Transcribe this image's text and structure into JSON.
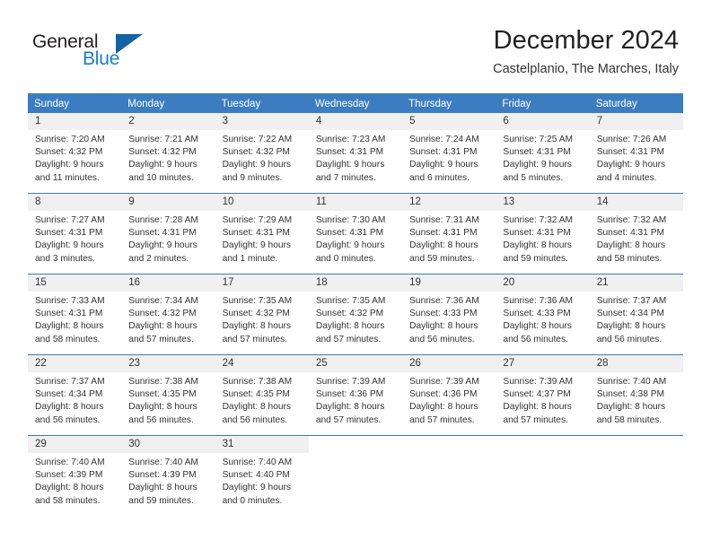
{
  "brand": {
    "name_top": "General",
    "name_bottom": "Blue",
    "triangle_icon": "triangle-icon",
    "color_dark": "#231f20",
    "color_blue": "#1a7fc1"
  },
  "header": {
    "title": "December 2024",
    "subtitle": "Castelplanio, The Marches, Italy"
  },
  "theme": {
    "header_row_bg": "#3b7dc0",
    "header_row_text": "#ffffff",
    "day_band_bg": "#f0f0f0",
    "body_text": "#333333"
  },
  "calendar": {
    "weekday_headers": [
      "Sunday",
      "Monday",
      "Tuesday",
      "Wednesday",
      "Thursday",
      "Friday",
      "Saturday"
    ],
    "weeks": [
      [
        {
          "day": "1",
          "sunrise": "Sunrise: 7:20 AM",
          "sunset": "Sunset: 4:32 PM",
          "daylight1": "Daylight: 9 hours",
          "daylight2": "and 11 minutes."
        },
        {
          "day": "2",
          "sunrise": "Sunrise: 7:21 AM",
          "sunset": "Sunset: 4:32 PM",
          "daylight1": "Daylight: 9 hours",
          "daylight2": "and 10 minutes."
        },
        {
          "day": "3",
          "sunrise": "Sunrise: 7:22 AM",
          "sunset": "Sunset: 4:32 PM",
          "daylight1": "Daylight: 9 hours",
          "daylight2": "and 9 minutes."
        },
        {
          "day": "4",
          "sunrise": "Sunrise: 7:23 AM",
          "sunset": "Sunset: 4:31 PM",
          "daylight1": "Daylight: 9 hours",
          "daylight2": "and 7 minutes."
        },
        {
          "day": "5",
          "sunrise": "Sunrise: 7:24 AM",
          "sunset": "Sunset: 4:31 PM",
          "daylight1": "Daylight: 9 hours",
          "daylight2": "and 6 minutes."
        },
        {
          "day": "6",
          "sunrise": "Sunrise: 7:25 AM",
          "sunset": "Sunset: 4:31 PM",
          "daylight1": "Daylight: 9 hours",
          "daylight2": "and 5 minutes."
        },
        {
          "day": "7",
          "sunrise": "Sunrise: 7:26 AM",
          "sunset": "Sunset: 4:31 PM",
          "daylight1": "Daylight: 9 hours",
          "daylight2": "and 4 minutes."
        }
      ],
      [
        {
          "day": "8",
          "sunrise": "Sunrise: 7:27 AM",
          "sunset": "Sunset: 4:31 PM",
          "daylight1": "Daylight: 9 hours",
          "daylight2": "and 3 minutes."
        },
        {
          "day": "9",
          "sunrise": "Sunrise: 7:28 AM",
          "sunset": "Sunset: 4:31 PM",
          "daylight1": "Daylight: 9 hours",
          "daylight2": "and 2 minutes."
        },
        {
          "day": "10",
          "sunrise": "Sunrise: 7:29 AM",
          "sunset": "Sunset: 4:31 PM",
          "daylight1": "Daylight: 9 hours",
          "daylight2": "and 1 minute."
        },
        {
          "day": "11",
          "sunrise": "Sunrise: 7:30 AM",
          "sunset": "Sunset: 4:31 PM",
          "daylight1": "Daylight: 9 hours",
          "daylight2": "and 0 minutes."
        },
        {
          "day": "12",
          "sunrise": "Sunrise: 7:31 AM",
          "sunset": "Sunset: 4:31 PM",
          "daylight1": "Daylight: 8 hours",
          "daylight2": "and 59 minutes."
        },
        {
          "day": "13",
          "sunrise": "Sunrise: 7:32 AM",
          "sunset": "Sunset: 4:31 PM",
          "daylight1": "Daylight: 8 hours",
          "daylight2": "and 59 minutes."
        },
        {
          "day": "14",
          "sunrise": "Sunrise: 7:32 AM",
          "sunset": "Sunset: 4:31 PM",
          "daylight1": "Daylight: 8 hours",
          "daylight2": "and 58 minutes."
        }
      ],
      [
        {
          "day": "15",
          "sunrise": "Sunrise: 7:33 AM",
          "sunset": "Sunset: 4:31 PM",
          "daylight1": "Daylight: 8 hours",
          "daylight2": "and 58 minutes."
        },
        {
          "day": "16",
          "sunrise": "Sunrise: 7:34 AM",
          "sunset": "Sunset: 4:32 PM",
          "daylight1": "Daylight: 8 hours",
          "daylight2": "and 57 minutes."
        },
        {
          "day": "17",
          "sunrise": "Sunrise: 7:35 AM",
          "sunset": "Sunset: 4:32 PM",
          "daylight1": "Daylight: 8 hours",
          "daylight2": "and 57 minutes."
        },
        {
          "day": "18",
          "sunrise": "Sunrise: 7:35 AM",
          "sunset": "Sunset: 4:32 PM",
          "daylight1": "Daylight: 8 hours",
          "daylight2": "and 57 minutes."
        },
        {
          "day": "19",
          "sunrise": "Sunrise: 7:36 AM",
          "sunset": "Sunset: 4:33 PM",
          "daylight1": "Daylight: 8 hours",
          "daylight2": "and 56 minutes."
        },
        {
          "day": "20",
          "sunrise": "Sunrise: 7:36 AM",
          "sunset": "Sunset: 4:33 PM",
          "daylight1": "Daylight: 8 hours",
          "daylight2": "and 56 minutes."
        },
        {
          "day": "21",
          "sunrise": "Sunrise: 7:37 AM",
          "sunset": "Sunset: 4:34 PM",
          "daylight1": "Daylight: 8 hours",
          "daylight2": "and 56 minutes."
        }
      ],
      [
        {
          "day": "22",
          "sunrise": "Sunrise: 7:37 AM",
          "sunset": "Sunset: 4:34 PM",
          "daylight1": "Daylight: 8 hours",
          "daylight2": "and 56 minutes."
        },
        {
          "day": "23",
          "sunrise": "Sunrise: 7:38 AM",
          "sunset": "Sunset: 4:35 PM",
          "daylight1": "Daylight: 8 hours",
          "daylight2": "and 56 minutes."
        },
        {
          "day": "24",
          "sunrise": "Sunrise: 7:38 AM",
          "sunset": "Sunset: 4:35 PM",
          "daylight1": "Daylight: 8 hours",
          "daylight2": "and 56 minutes."
        },
        {
          "day": "25",
          "sunrise": "Sunrise: 7:39 AM",
          "sunset": "Sunset: 4:36 PM",
          "daylight1": "Daylight: 8 hours",
          "daylight2": "and 57 minutes."
        },
        {
          "day": "26",
          "sunrise": "Sunrise: 7:39 AM",
          "sunset": "Sunset: 4:36 PM",
          "daylight1": "Daylight: 8 hours",
          "daylight2": "and 57 minutes."
        },
        {
          "day": "27",
          "sunrise": "Sunrise: 7:39 AM",
          "sunset": "Sunset: 4:37 PM",
          "daylight1": "Daylight: 8 hours",
          "daylight2": "and 57 minutes."
        },
        {
          "day": "28",
          "sunrise": "Sunrise: 7:40 AM",
          "sunset": "Sunset: 4:38 PM",
          "daylight1": "Daylight: 8 hours",
          "daylight2": "and 58 minutes."
        }
      ],
      [
        {
          "day": "29",
          "sunrise": "Sunrise: 7:40 AM",
          "sunset": "Sunset: 4:39 PM",
          "daylight1": "Daylight: 8 hours",
          "daylight2": "and 58 minutes."
        },
        {
          "day": "30",
          "sunrise": "Sunrise: 7:40 AM",
          "sunset": "Sunset: 4:39 PM",
          "daylight1": "Daylight: 8 hours",
          "daylight2": "and 59 minutes."
        },
        {
          "day": "31",
          "sunrise": "Sunrise: 7:40 AM",
          "sunset": "Sunset: 4:40 PM",
          "daylight1": "Daylight: 9 hours",
          "daylight2": "and 0 minutes."
        },
        {
          "day": "",
          "sunrise": "",
          "sunset": "",
          "daylight1": "",
          "daylight2": ""
        },
        {
          "day": "",
          "sunrise": "",
          "sunset": "",
          "daylight1": "",
          "daylight2": ""
        },
        {
          "day": "",
          "sunrise": "",
          "sunset": "",
          "daylight1": "",
          "daylight2": ""
        },
        {
          "day": "",
          "sunrise": "",
          "sunset": "",
          "daylight1": "",
          "daylight2": ""
        }
      ]
    ]
  }
}
